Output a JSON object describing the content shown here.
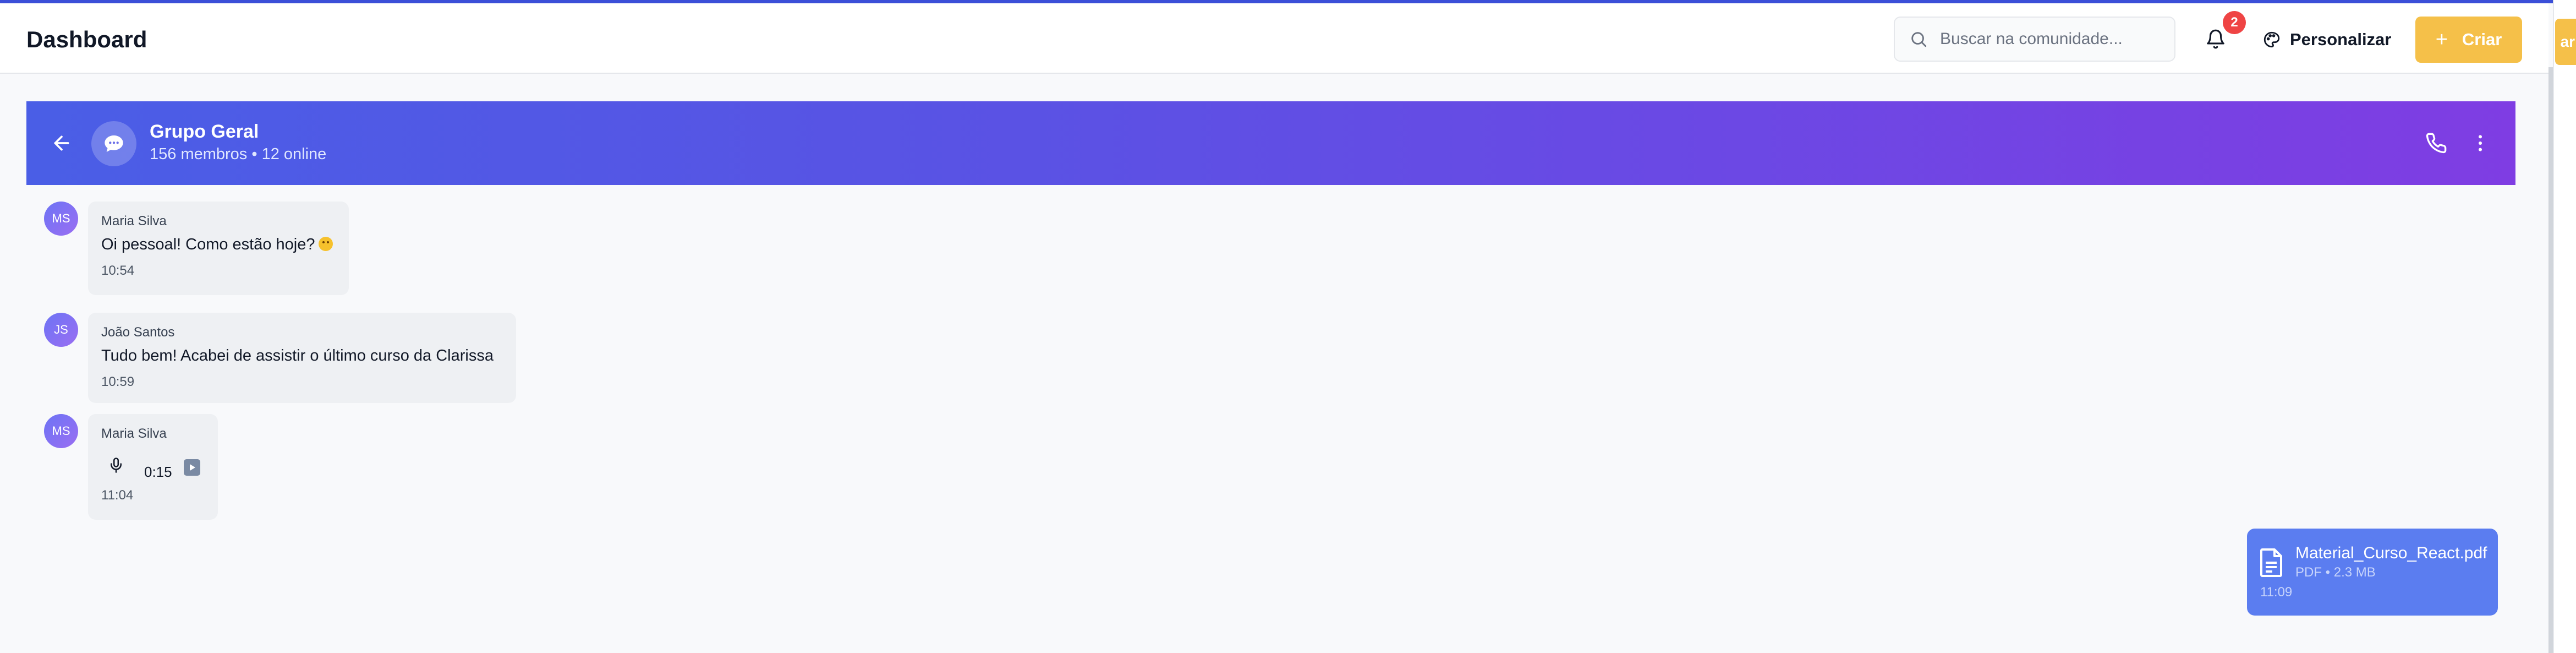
{
  "header": {
    "title": "Dashboard",
    "search_placeholder": "Buscar na comunidade...",
    "notification_count": "2",
    "personalize_label": "Personalizar",
    "create_label": "Criar",
    "edge_button_label": "ar"
  },
  "chat": {
    "group_name": "Grupo Geral",
    "group_meta": "156 membros • 12 online"
  },
  "messages": [
    {
      "initials": "MS",
      "sender": "Maria Silva",
      "text": "Oi pessoal! Como estão hoje?",
      "time": "10:54"
    },
    {
      "initials": "JS",
      "sender": "João Santos",
      "text": "Tudo bem! Acabei de assistir o último curso da Clarissa",
      "time": "10:59"
    },
    {
      "initials": "MS",
      "sender": "Maria Silva",
      "audio_duration": "0:15",
      "time": "11:04"
    }
  ],
  "file_message": {
    "file_name": "Material_Curso_React.pdf",
    "file_meta": "PDF • 2.3 MB",
    "time": "11:09"
  },
  "colors": {
    "accent_yellow": "#f5c049",
    "header_gradient_start": "#4a5ee6",
    "header_gradient_end": "#7f3de3",
    "file_bubble": "#5b7df0",
    "badge": "#ef4444"
  },
  "icons": [
    "search-icon",
    "bell-icon",
    "palette-icon",
    "plus-icon",
    "back-arrow-icon",
    "chat-bubble-icon",
    "phone-icon",
    "more-vertical-icon",
    "mic-icon",
    "play-icon",
    "file-icon",
    "smile-emoji-icon"
  ]
}
